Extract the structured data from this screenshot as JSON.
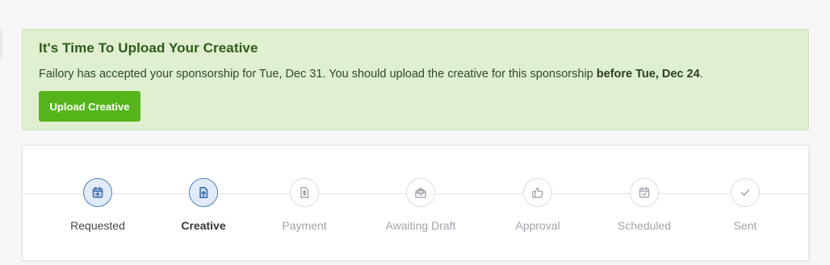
{
  "alert": {
    "title": "It's Time To Upload Your Creative",
    "message_prefix": "Failory has accepted your sponsorship for Tue, Dec 31. You should upload the creative for this sponsorship ",
    "message_deadline": "before Tue, Dec 24",
    "message_suffix": ".",
    "button_label": "Upload Creative",
    "colors": {
      "background": "#dfefd0",
      "title": "#2f5a1c",
      "button": "#55b41a"
    }
  },
  "progress": {
    "steps": [
      {
        "label": "Requested",
        "icon": "calendar-plus-icon",
        "state": "done"
      },
      {
        "label": "Creative",
        "icon": "file-upload-icon",
        "state": "current"
      },
      {
        "label": "Payment",
        "icon": "invoice-dollar-icon",
        "state": "pending"
      },
      {
        "label": "Awaiting Draft",
        "icon": "envelope-open-icon",
        "state": "pending"
      },
      {
        "label": "Approval",
        "icon": "thumbs-up-icon",
        "state": "pending"
      },
      {
        "label": "Scheduled",
        "icon": "calendar-check-icon",
        "state": "pending"
      },
      {
        "label": "Sent",
        "icon": "check-icon",
        "state": "pending"
      }
    ],
    "colors": {
      "active_icon": "#3c6fb0",
      "active_fill": "#e1ebf8",
      "pending_icon": "#9fa1a8"
    }
  }
}
